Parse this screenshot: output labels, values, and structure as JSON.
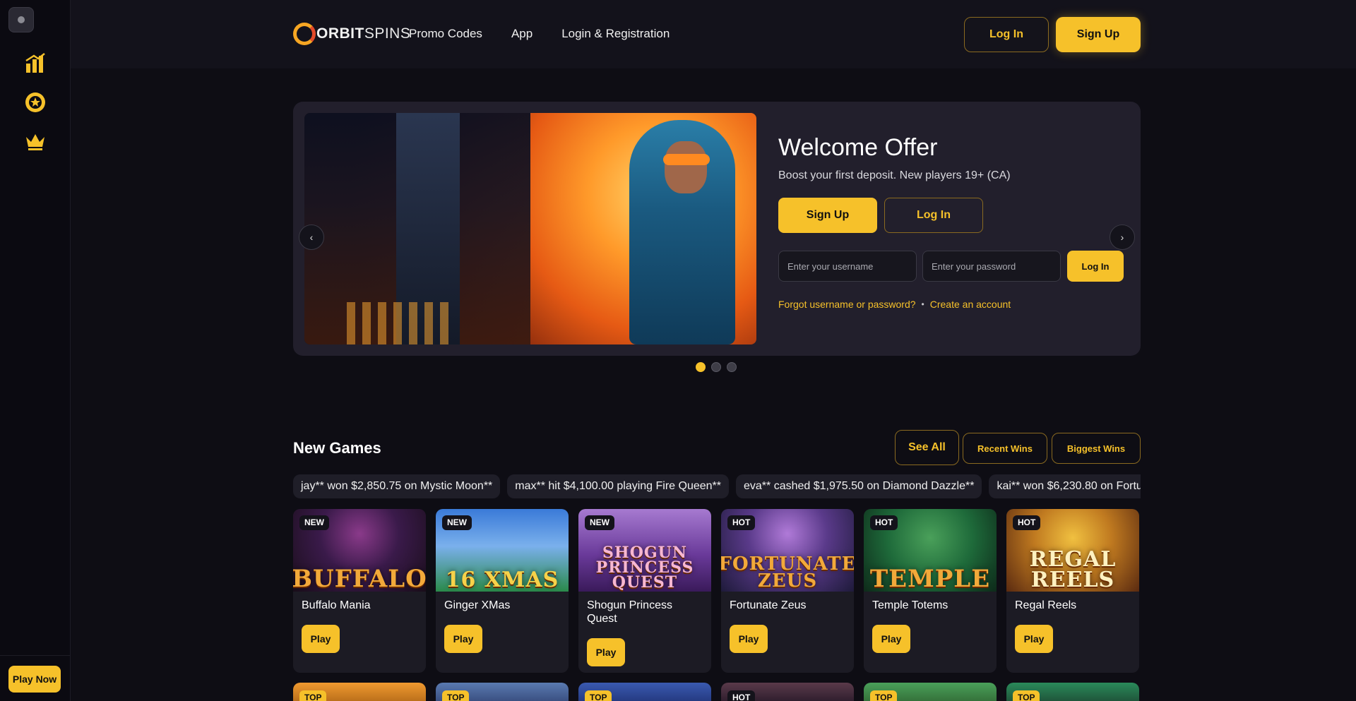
{
  "sidebar": {
    "icons": [
      "chart-bars-icon",
      "gear-star-icon",
      "crown-icon"
    ],
    "play_now": "Play Now"
  },
  "header": {
    "logo_orbit": "ORBIT",
    "logo_spins": "SPINS",
    "nav": [
      "Promo Codes",
      "App",
      "Login & Registration"
    ],
    "login": "Log In",
    "signup": "Sign Up"
  },
  "hero": {
    "title": "Welcome Offer",
    "subtitle": "Boost your first deposit. New players 19+ (CA)",
    "signup": "Sign Up",
    "login": "Log In",
    "username_placeholder": "Enter your username",
    "password_placeholder": "Enter your password",
    "form_login": "Log In",
    "forgot": "Forgot username or password?",
    "separator": "•",
    "create": "Create an account",
    "prev": "‹",
    "next": "›",
    "active_slide": 1,
    "slide_count": 3
  },
  "games_section": {
    "title": "New Games",
    "see_all": "See All",
    "recent_wins": "Recent Wins",
    "biggest_wins": "Biggest Wins",
    "ticker": [
      "jay** won $2,850.75 on Mystic Moon**",
      "max** hit $4,100.00 playing Fire Queen**",
      "eva** cashed $1,975.50 on Diamond Dazzle**",
      "kai** won $6,230.80 on Fortu"
    ],
    "games": [
      {
        "badge": "NEW",
        "name": "Buffalo Mania",
        "art": "BUFFALO",
        "play": "Play"
      },
      {
        "badge": "NEW",
        "name": "Ginger XMas",
        "art": "16 XMAS",
        "play": "Play"
      },
      {
        "badge": "NEW",
        "name": "Shogun Princess Quest",
        "art": "SHOGUN PRINCESS QUEST",
        "play": "Play"
      },
      {
        "badge": "HOT",
        "name": "Fortunate Zeus",
        "art": "FORTUNATE ZEUS",
        "play": "Play"
      },
      {
        "badge": "HOT",
        "name": "Temple Totems",
        "art": "TEMPLE",
        "play": "Play"
      },
      {
        "badge": "HOT",
        "name": "Regal Reels",
        "art": "REGAL REELS",
        "play": "Play"
      }
    ],
    "row2_badges": [
      "TOP",
      "TOP",
      "TOP",
      "HOT",
      "TOP",
      "TOP"
    ]
  },
  "colors": {
    "accent": "#f6c12a",
    "background": "#0e0d14",
    "panel": "#221f2c"
  }
}
